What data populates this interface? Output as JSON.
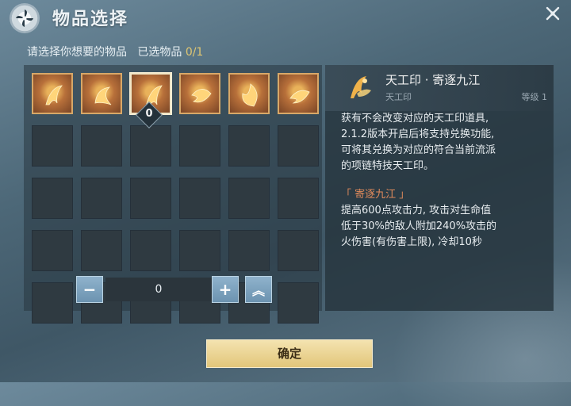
{
  "dialog": {
    "title": "物品选择",
    "subtitle_prompt": "请选择你想要的物品",
    "subtitle_selected_label": "已选物品",
    "subtitle_selected_count": "0/1"
  },
  "icons": {
    "logo": "pinwheel-logo-icon",
    "close": "close-x-icon"
  },
  "grid": {
    "rows": 5,
    "columns": 6,
    "items": [
      {
        "name": "rune-item-1",
        "selected": false
      },
      {
        "name": "rune-item-2",
        "selected": false
      },
      {
        "name": "rune-item-3",
        "selected": true
      },
      {
        "name": "rune-item-4",
        "selected": false
      },
      {
        "name": "rune-item-5",
        "selected": false
      },
      {
        "name": "rune-item-6",
        "selected": false
      }
    ],
    "selected_badge": "0"
  },
  "stepper": {
    "minus_label": "−",
    "plus_label": "+",
    "max_label": "︽",
    "value": "0"
  },
  "detail": {
    "name": "天工印 · 寄逐九江",
    "type": "天工印",
    "level": "等级 1",
    "lines_intro": [
      "获有不会改变对应的天工印道具,",
      "2.1.2版本开启后将支持兑换功能,",
      "可将其兑换为对应的符合当前流派",
      "的项链特技天工印。"
    ],
    "effect_title": "「 寄逐九江 」",
    "lines_effect": [
      "提高600点攻击力, 攻击对生命值",
      "低于30%的敌人附加240%攻击的",
      "火伤害(有伤害上限), 冷却10秒"
    ]
  },
  "confirm_label": "确定",
  "colors": {
    "accent_gold": "#e0c772",
    "highlight_orange": "#e08a5b",
    "item_border": "#d8a868"
  }
}
